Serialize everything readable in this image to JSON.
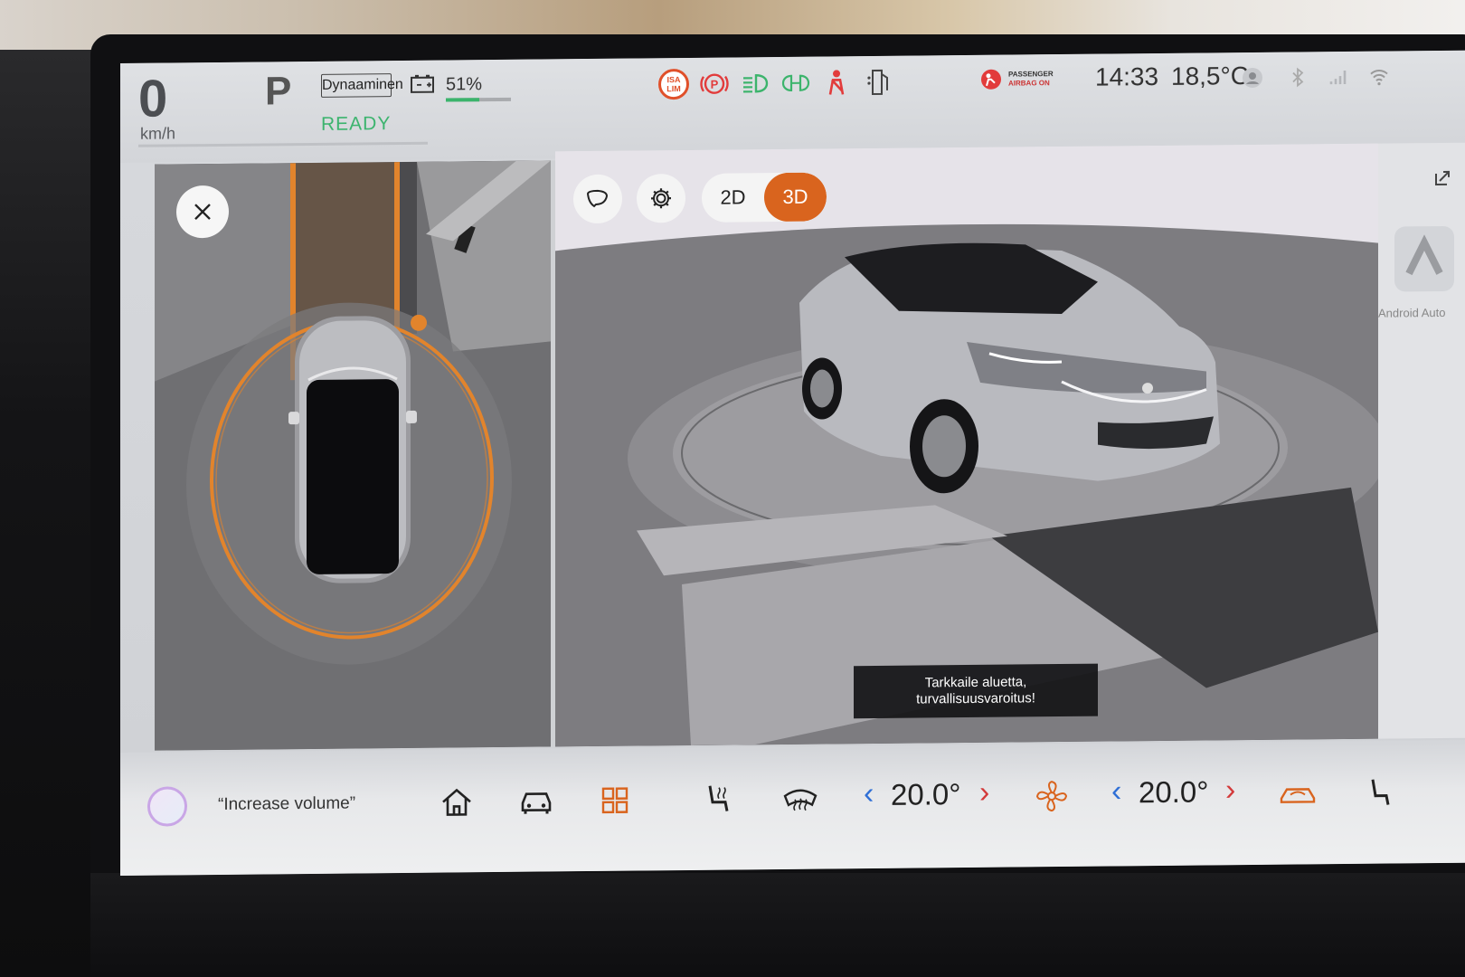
{
  "status": {
    "speed": "0",
    "speed_unit": "km/h",
    "gear": "P",
    "drive_mode": "Dynaaminen",
    "ready": "READY",
    "battery_percent": "51%",
    "battery_level": 0.51,
    "isa_label": "ISA LIM",
    "passenger_airbag_line1": "PASSENGER",
    "passenger_airbag_line2": "AIRBAG ON",
    "time": "14:33",
    "outside_temp": "18,5°C"
  },
  "view_controls": {
    "mode_2d": "2D",
    "mode_3d": "3D",
    "active_mode": "3D"
  },
  "warning": {
    "line1": "Tarkkaile aluetta,",
    "line2": "turvallisuusvaroitus!"
  },
  "side_panel": {
    "android_auto_label": "Android Auto"
  },
  "bottom_bar": {
    "voice_hint": "“Increase volume”",
    "driver_temp": "20.0°",
    "passenger_temp": "20.0°",
    "left_arrow": "‹",
    "right_arrow": "›"
  },
  "colors": {
    "accent_orange": "#d9641e",
    "ready_green": "#3cb46c",
    "warning_red": "#d33b3b",
    "temp_left_blue": "#2f6fd6"
  }
}
